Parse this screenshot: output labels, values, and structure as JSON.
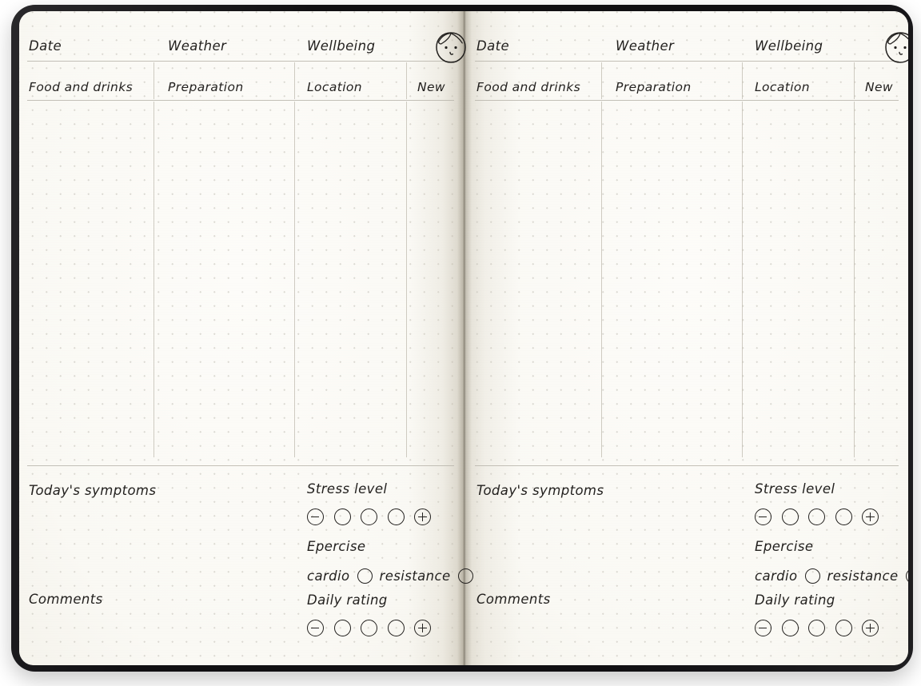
{
  "notebook": {
    "cover_color": "#111013",
    "paper_color": "#faf9f4",
    "ink_color": "#23211f",
    "rule_color": "#b9b5ab",
    "dot_color": "#c9c6bd"
  },
  "page": {
    "header_row": {
      "date_label": "Date",
      "weather_label": "Weather",
      "wellbeing_label": "Wellbeing",
      "face_icon": "face-doodle-icon"
    },
    "table_header": {
      "food_label": "Food and drinks",
      "preparation_label": "Preparation",
      "location_label": "Location",
      "new_label": "New"
    },
    "footer": {
      "symptoms_label": "Today's symptoms",
      "comments_label": "Comments",
      "stress_label": "Stress level",
      "exercise_label": "Epercise",
      "cardio_label": "cardio",
      "resistance_label": "resistance",
      "daily_rating_label": "Daily rating",
      "scale_min_icon": "minus-icon",
      "scale_max_icon": "plus-icon",
      "scale_steps": 5
    }
  }
}
